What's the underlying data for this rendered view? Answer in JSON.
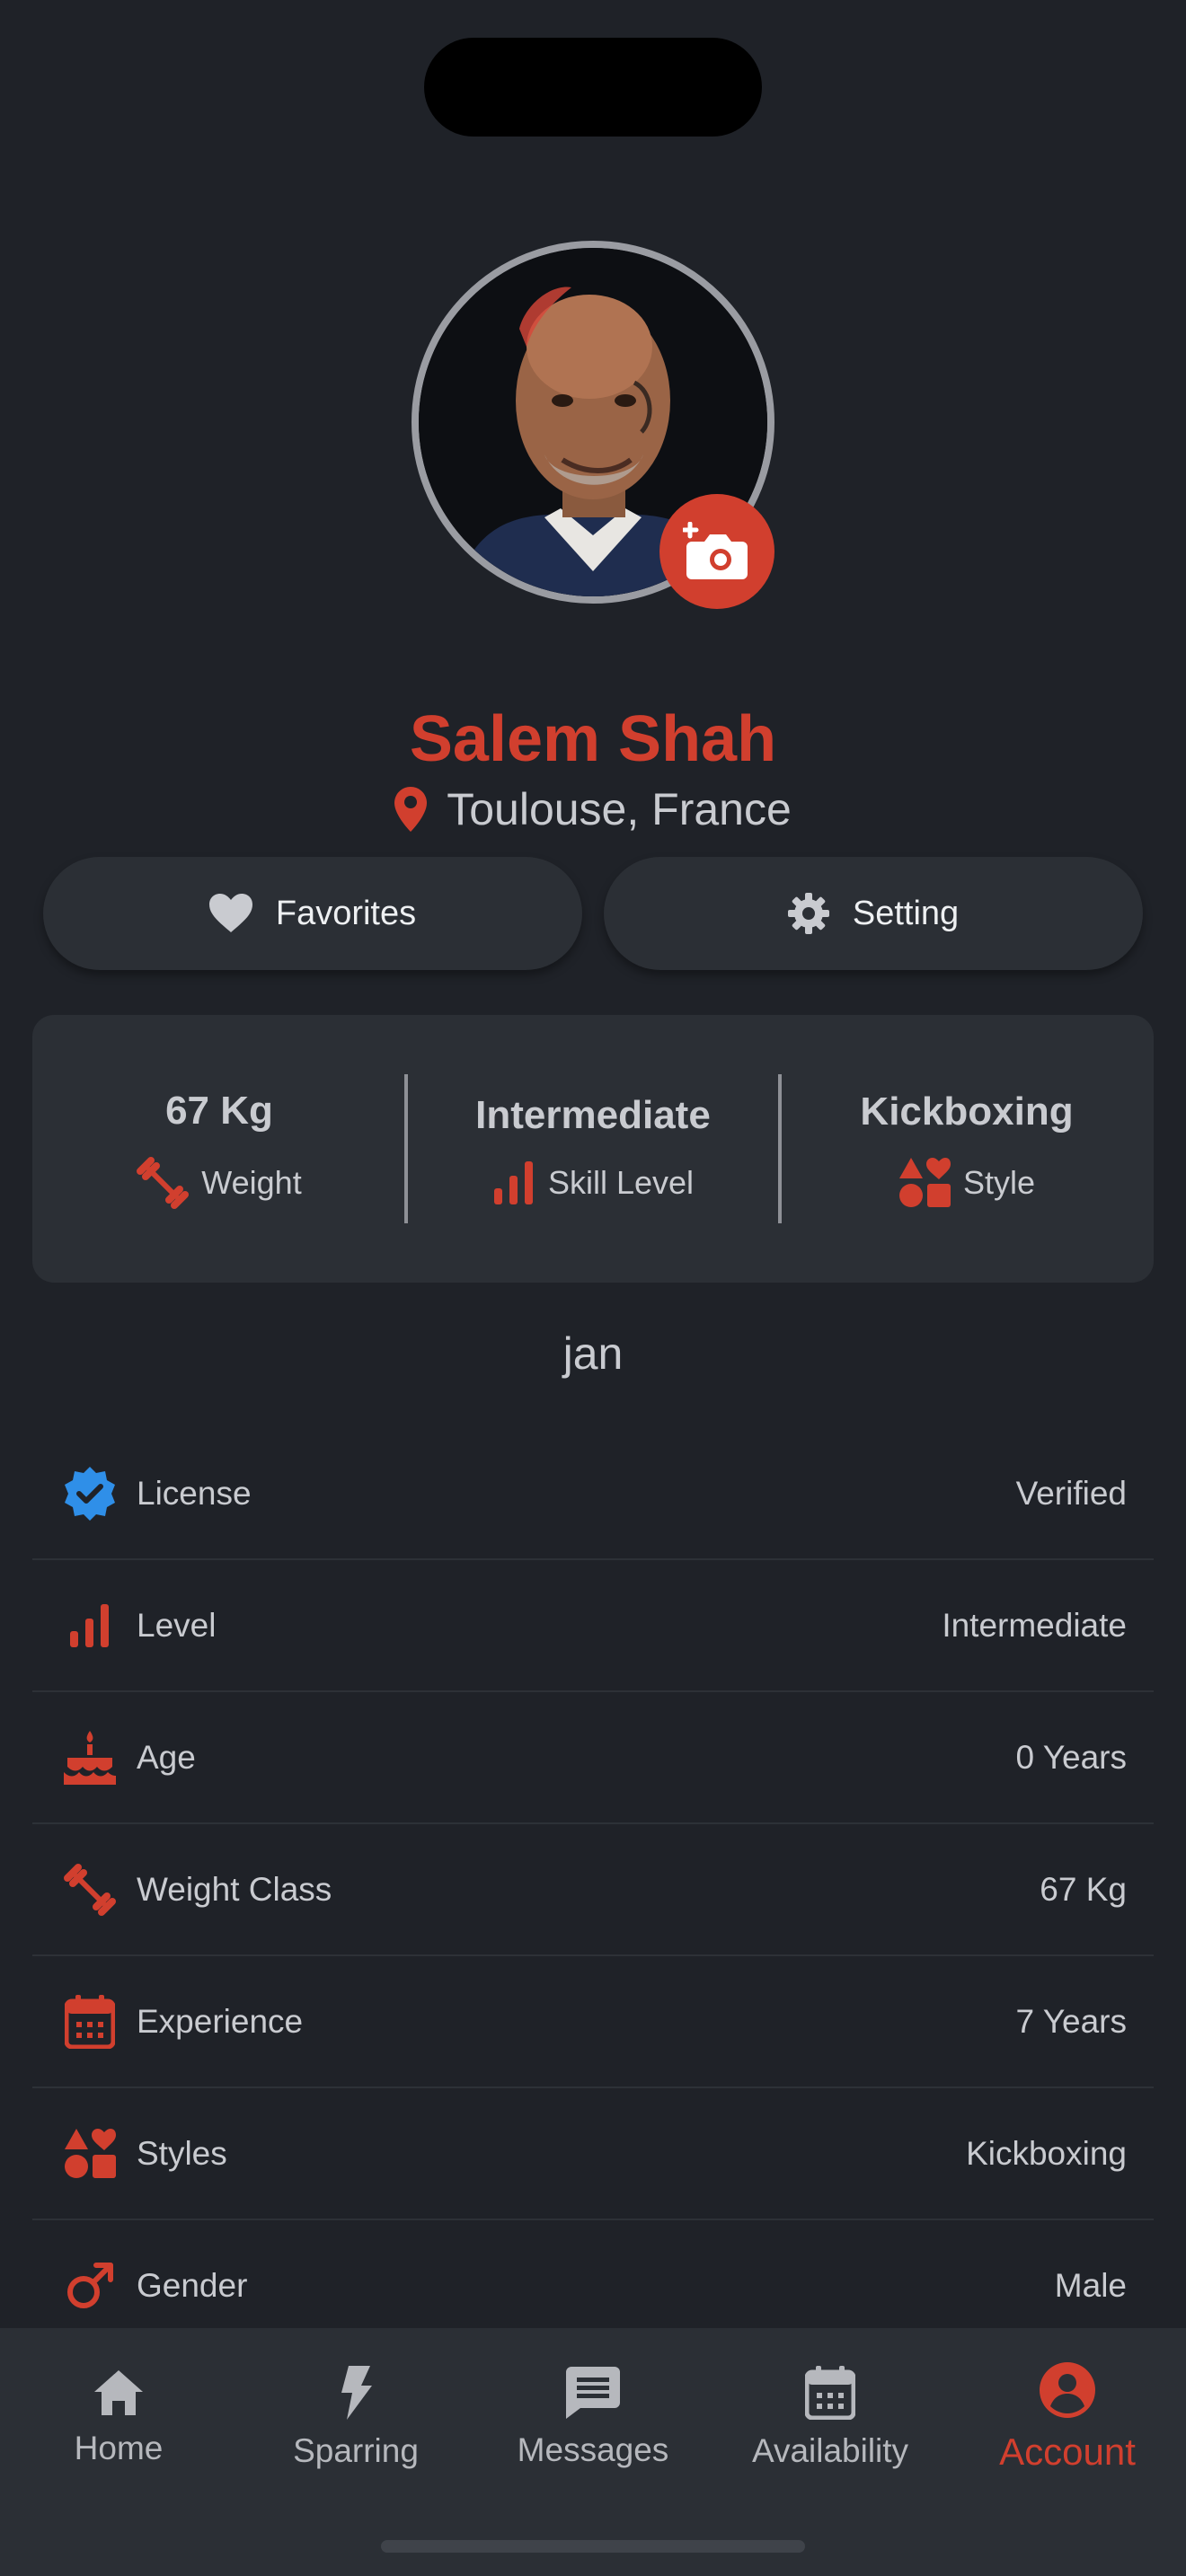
{
  "profile": {
    "name": "Salem Shah",
    "location": "Toulouse, France",
    "username": "jan"
  },
  "actions": {
    "favorites_label": "Favorites",
    "setting_label": "Setting"
  },
  "stats": [
    {
      "value": "67 Kg",
      "label": "Weight",
      "icon": "dumbbell-icon"
    },
    {
      "value": "Intermediate",
      "label": "Skill Level",
      "icon": "signal-bars-icon"
    },
    {
      "value": "Kickboxing",
      "label": "Style",
      "icon": "shapes-icon"
    }
  ],
  "details": [
    {
      "key": "License",
      "value": "Verified",
      "icon": "verified-badge-icon"
    },
    {
      "key": "Level",
      "value": "Intermediate",
      "icon": "signal-bars-icon"
    },
    {
      "key": "Age",
      "value": "0 Years",
      "icon": "cake-icon"
    },
    {
      "key": "Weight Class",
      "value": "67 Kg",
      "icon": "dumbbell-icon"
    },
    {
      "key": "Experience",
      "value": "7 Years",
      "icon": "calendar-icon"
    },
    {
      "key": "Styles",
      "value": "Kickboxing",
      "icon": "shapes-icon"
    },
    {
      "key": "Gender",
      "value": "Male",
      "icon": "male-icon"
    }
  ],
  "tabs": [
    {
      "label": "Home",
      "icon": "home-icon"
    },
    {
      "label": "Sparring",
      "icon": "lightning-icon"
    },
    {
      "label": "Messages",
      "icon": "message-icon"
    },
    {
      "label": "Availability",
      "icon": "calendar-icon"
    },
    {
      "label": "Account",
      "icon": "account-icon",
      "active": true
    }
  ],
  "colors": {
    "accent": "#d13f2e",
    "background": "#1f2228",
    "card": "#2b2f35",
    "verified": "#2f8fe8"
  }
}
